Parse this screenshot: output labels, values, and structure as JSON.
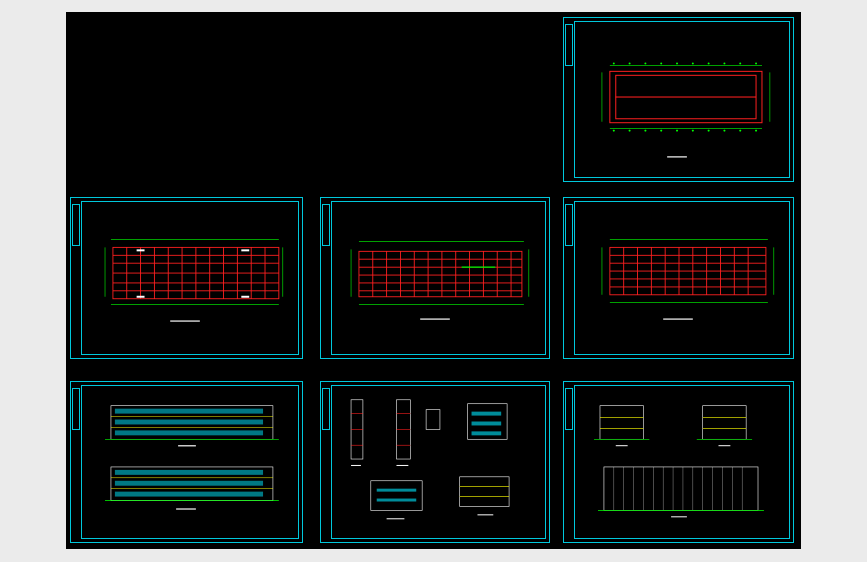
{
  "viewer": {
    "background_color": "#ebebeb",
    "canvas_color": "#000000",
    "frame_color": "#00c8dc"
  },
  "sheets": [
    {
      "id": "roof-plan",
      "kind": "plan",
      "title": ""
    },
    {
      "id": "floor-plan-1",
      "kind": "plan",
      "title": ""
    },
    {
      "id": "floor-plan-2",
      "kind": "plan",
      "title": ""
    },
    {
      "id": "floor-plan-3",
      "kind": "plan",
      "title": ""
    },
    {
      "id": "elevations",
      "kind": "elevation",
      "title": ""
    },
    {
      "id": "sections",
      "kind": "section",
      "title": ""
    },
    {
      "id": "side-elevations",
      "kind": "elevation",
      "title": ""
    }
  ]
}
